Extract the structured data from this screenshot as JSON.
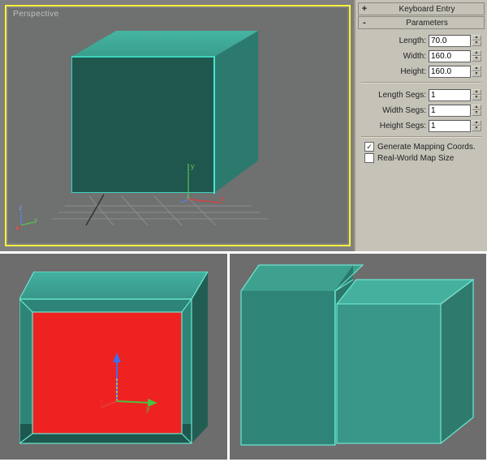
{
  "viewport": {
    "label": "Perspective",
    "axis_labels": {
      "x": "x",
      "y": "y",
      "z": "z"
    }
  },
  "side_panel": {
    "rollouts": [
      {
        "toggle": "+",
        "title": "Keyboard Entry"
      },
      {
        "toggle": "-",
        "title": "Parameters"
      }
    ],
    "params": {
      "length_label": "Length:",
      "length_value": "70.0",
      "width_label": "Width:",
      "width_value": "160.0",
      "height_label": "Height:",
      "height_value": "160.0",
      "length_segs_label": "Length Segs:",
      "length_segs_value": "1",
      "width_segs_label": "Width Segs:",
      "width_segs_value": "1",
      "height_segs_label": "Height Segs:",
      "height_segs_value": "1"
    },
    "checks": {
      "gen_mapping": {
        "checked": true,
        "label": "Generate Mapping Coords."
      },
      "real_world": {
        "checked": false,
        "label": "Real-World Map Size"
      }
    }
  },
  "spinner_glyphs": {
    "up": "▴",
    "down": "▾"
  },
  "checkmark_glyph": "✓",
  "colors": {
    "panel_bg": "#c5c2b8",
    "viewport_bg": "#6f7070",
    "selection_border": "#f5f53a",
    "box_primary": "#2e8577",
    "box_highlight": "#3dd4bd",
    "selected_face": "#ef2222",
    "axis_x": "#e63a3a",
    "axis_y": "#59c24e",
    "axis_z": "#5884e6"
  }
}
